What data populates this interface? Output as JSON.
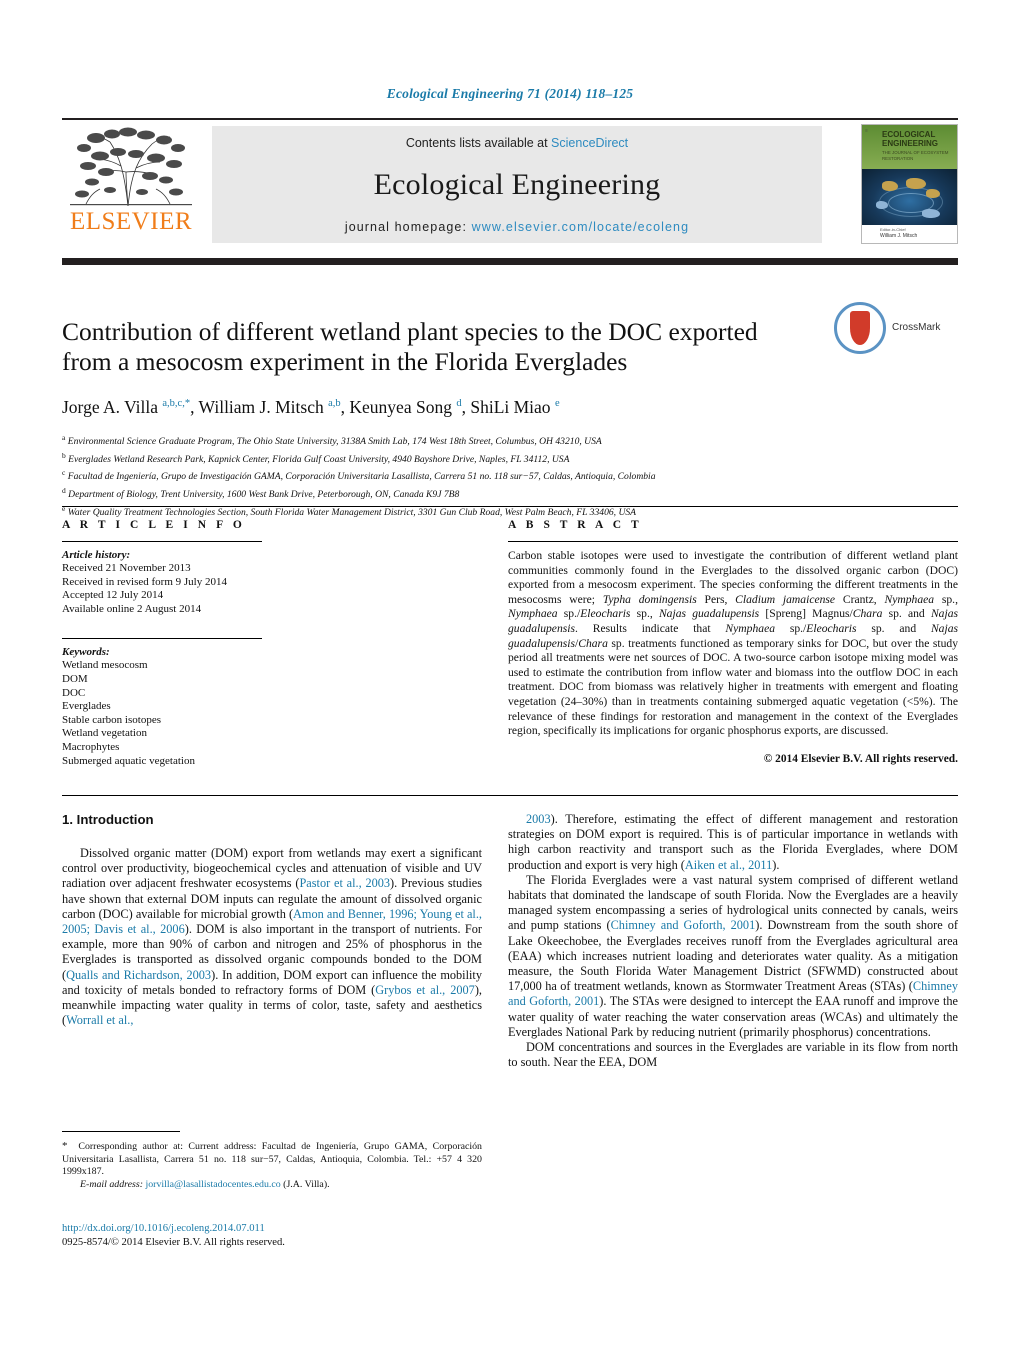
{
  "running_head": "Ecological Engineering 71 (2014) 118–125",
  "masthead": {
    "contents_prefix": "Contents lists available at ",
    "contents_link": "ScienceDirect",
    "journal_name": "Ecological Engineering",
    "homepage_prefix": "journal homepage:",
    "homepage_url": "www.elsevier.com/locate/ecoleng",
    "publisher": "ELSEVIER",
    "cover": {
      "title": "ECOLOGICAL ENGINEERING",
      "subtitle": "THE JOURNAL OF ECOSYSTEM RESTORATION",
      "footer_small": "Editor-in-Chief",
      "footer_name": "William J. Mitsch"
    }
  },
  "article": {
    "title": "Contribution of different wetland plant species to the DOC exported from a mesocosm experiment in the Florida Everglades",
    "crossmark_label": "CrossMark",
    "authors_html": "Jorge A. Villa <sup>a,b,c,</sup><sup>*</sup>, William J. Mitsch <sup>a,b</sup>, Keunyea Song <sup>d</sup>, ShiLi Miao <sup>e</sup>",
    "affiliations": [
      {
        "mark": "a",
        "text": "Environmental Science Graduate Program, The Ohio State University, 3138A Smith Lab, 174 West 18th Street, Columbus, OH 43210, USA"
      },
      {
        "mark": "b",
        "text": "Everglades Wetland Research Park, Kapnick Center, Florida Gulf Coast University, 4940 Bayshore Drive, Naples, FL 34112, USA"
      },
      {
        "mark": "c",
        "text": "Facultad de Ingeniería, Grupo de Investigación GAMA, Corporación Universitaria Lasallista, Carrera 51 no. 118 sur−57, Caldas, Antioquia, Colombia"
      },
      {
        "mark": "d",
        "text": "Department of Biology, Trent University, 1600 West Bank Drive, Peterborough, ON, Canada K9J 7B8"
      },
      {
        "mark": "e",
        "text": "Water Quality Treatment Technologies Section, South Florida Water Management District, 3301 Gun Club Road, West Palm Beach, FL 33406, USA"
      }
    ]
  },
  "article_info": {
    "heading": "A R T I C L E   I N F O",
    "history_label": "Article history:",
    "history": [
      "Received 21 November 2013",
      "Received in revised form 9 July 2014",
      "Accepted 12 July 2014",
      "Available online 2 August 2014"
    ],
    "keywords_label": "Keywords:",
    "keywords": [
      "Wetland mesocosm",
      "DOM",
      "DOC",
      "Everglades",
      "Stable carbon isotopes",
      "Wetland vegetation",
      "Macrophytes",
      "Submerged aquatic vegetation"
    ]
  },
  "abstract": {
    "heading": "A B S T R A C T",
    "html": "Carbon stable isotopes were used to investigate the contribution of different wetland plant communities commonly found in the Everglades to the dissolved organic carbon (DOC) exported from a mesocosm experiment. The species conforming the different treatments in the mesocosms were; <i>Typha domingensis</i> Pers, <i>Cladium jamaicense</i> Crantz, <i>Nymphaea</i> sp., <i>Nymphaea</i> sp./<i>Eleocharis</i> sp., <i>Najas guadalupensis</i> [Spreng] Magnus/<i>Chara</i> sp. and <i>Najas guadalupensis</i>. Results indicate that <i>Nymphaea</i> sp./<i>Eleocharis</i> sp. and <i>Najas guadalupensis</i>/<i>Chara</i> sp. treatments functioned as temporary sinks for DOC, but over the study period all treatments were net sources of DOC. A two-source carbon isotope mixing model was used to estimate the contribution from inflow water and biomass into the outflow DOC in each treatment. DOC from biomass was relatively higher in treatments with emergent and floating vegetation (24–30%) than in treatments containing submerged aquatic vegetation (&lt;5%). The relevance of these findings for restoration and management in the context of the Everglades region, specifically its implications for organic phosphorus exports, are discussed.",
    "copyright": "© 2014 Elsevier B.V. All rights reserved."
  },
  "body": {
    "section_heading": "1.  Introduction",
    "left_paragraphs_html": [
      "Dissolved organic matter (DOM) export from wetlands may exert a significant control over productivity, biogeochemical cycles and attenuation of visible and UV radiation over adjacent freshwater ecosystems (<span class=\"lnk\">Pastor et al., 2003</span>). Previous studies have shown that external DOM inputs can regulate the amount of dissolved organic carbon (DOC) available for microbial growth (<span class=\"lnk\">Amon and Benner, 1996; Young et al., 2005; Davis et al., 2006</span>). DOM is also important in the transport of nutrients. For example, more than 90% of carbon and nitrogen and 25% of phosphorus in the Everglades is transported as dissolved organic compounds bonded to the DOM (<span class=\"lnk\">Qualls and Richardson, 2003</span>). In addition, DOM export can influence the mobility and toxicity of metals bonded to refractory forms of DOM (<span class=\"lnk\">Grybos et al., 2007</span>), meanwhile impacting water quality in terms of color, taste, safety and aesthetics (<span class=\"lnk\">Worrall et al.,</span>"
    ],
    "right_paragraphs_html": [
      "<span class=\"lnk\">2003</span>). Therefore, estimating the effect of different management and restoration strategies on DOM export is required. This is of particular importance in wetlands with high carbon reactivity and transport such as the Florida Everglades, where DOM production and export is very high (<span class=\"lnk\">Aiken et al., 2011</span>).",
      "The Florida Everglades were a vast natural system comprised of different wetland habitats that dominated the landscape of south Florida. Now the Everglades are a heavily managed system encompassing a series of hydrological units connected by canals, weirs and pump stations (<span class=\"lnk\">Chimney and Goforth, 2001</span>). Downstream from the south shore of Lake Okeechobee, the Everglades receives runoff from the Everglades agricultural area (EAA) which increases nutrient loading and deteriorates water quality. As a mitigation measure, the South Florida Water Management District (SFWMD) constructed about 17,000 ha of treatment wetlands, known as Stormwater Treatment Areas (STAs) (<span class=\"lnk\">Chimney and Goforth, 2001</span>). The STAs were designed to intercept the EAA runoff and improve the water quality of water reaching the water conservation areas (WCAs) and ultimately the Everglades National Park by reducing nutrient (primarily phosphorus) concentrations.",
      "DOM concentrations and sources in the Everglades are variable in its flow from north to south. Near the EEA, DOM"
    ]
  },
  "footnote": {
    "html": "<span class=\"star\">*</span>&nbsp; Corresponding author at: Current address: Facultad de Ingeniería, Grupo GAMA, Corporación Universitaria Lasallista, Carrera 51 no. 118 sur−57, Caldas, Antioquia, Colombia. Tel.: +57 4 320 1999x187.",
    "email_label": "E-mail address:",
    "email": "jorvilla@lasallistadocentes.edu.co",
    "email_suffix": "(J.A. Villa)."
  },
  "doi_block": {
    "doi": "http://dx.doi.org/10.1016/j.ecoleng.2014.07.011",
    "issn_line": "0925-8574/© 2014 Elsevier B.V. All rights reserved."
  }
}
